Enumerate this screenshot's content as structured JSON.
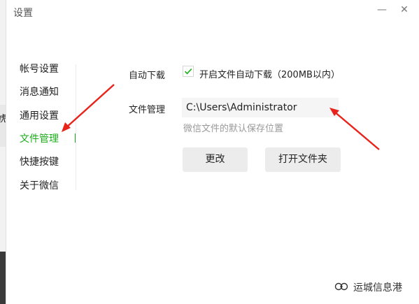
{
  "window": {
    "title": "设置",
    "minimize_label": "—",
    "close_label": "✕"
  },
  "background": {
    "fragment": "虎"
  },
  "sidebar": {
    "items": [
      {
        "label": "帐号设置"
      },
      {
        "label": "消息通知"
      },
      {
        "label": "通用设置"
      },
      {
        "label": "文件管理",
        "active": true
      },
      {
        "label": "快捷按键"
      },
      {
        "label": "关于微信"
      }
    ],
    "active_color": "#1aad19"
  },
  "settings": {
    "auto_download": {
      "label": "自动下载",
      "checkbox_label": "开启文件自动下载（200MB以内）",
      "checked": true
    },
    "file_management": {
      "label": "文件管理",
      "path_value": "C:\\Users\\Administrator",
      "hint": "微信文件的默认保存位置"
    },
    "buttons": {
      "change_label": "更改",
      "open_folder_label": "打开文件夹"
    }
  },
  "annotations": {
    "arrow_color": "#e8231c"
  },
  "watermark": {
    "text": "运城信息港",
    "icon": "wechat-channel-icon"
  }
}
